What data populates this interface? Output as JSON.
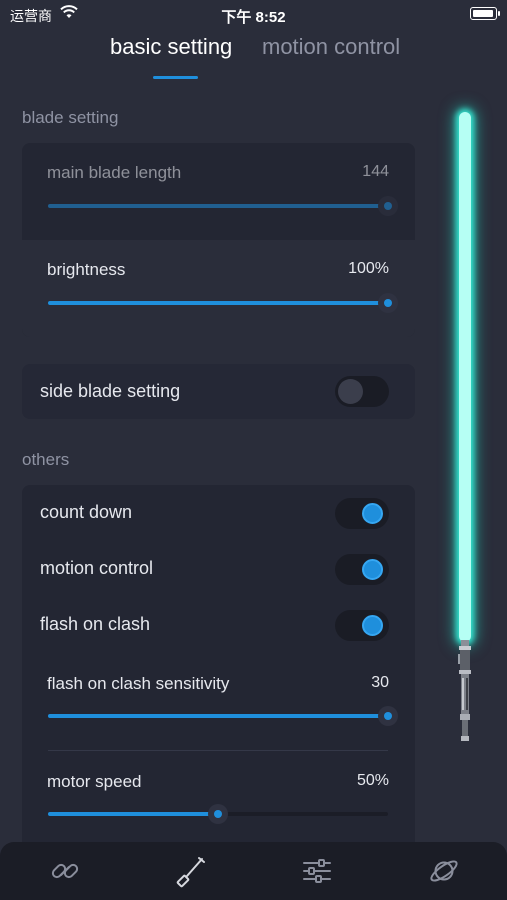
{
  "status_bar": {
    "carrier": "运营商",
    "time": "下午 8:52"
  },
  "tabs": [
    {
      "label": "basic setting",
      "active": true
    },
    {
      "label": "motion control",
      "active": false
    }
  ],
  "blade_setting": {
    "section_label": "blade setting",
    "main_blade_length": {
      "label": "main blade length",
      "value": "144",
      "level": 1.0,
      "dimmed": true
    },
    "brightness": {
      "label": "brightness",
      "value": "100%",
      "level": 1.0
    }
  },
  "side_blade_setting": {
    "label": "side blade setting",
    "on": false
  },
  "others": {
    "section_label": "others",
    "count_down": {
      "label": "count down",
      "on": true
    },
    "motion_control": {
      "label": "motion control",
      "on": true
    },
    "flash_on_clash": {
      "label": "flash on clash",
      "on": true
    },
    "flash_on_clash_sensitivity": {
      "label": "flash on clash sensitivity",
      "value": "30",
      "level": 1.0
    },
    "motor_speed": {
      "label": "motor speed",
      "value": "50%",
      "level": 0.5
    }
  },
  "bottom_nav": [
    {
      "icon": "link-icon"
    },
    {
      "icon": "saber-icon"
    },
    {
      "icon": "sliders-icon"
    },
    {
      "icon": "planet-icon"
    }
  ],
  "colors": {
    "accent": "#1f8fdc",
    "blade": "#34e3cf",
    "background": "#2a2d3a",
    "card": "#232633"
  }
}
